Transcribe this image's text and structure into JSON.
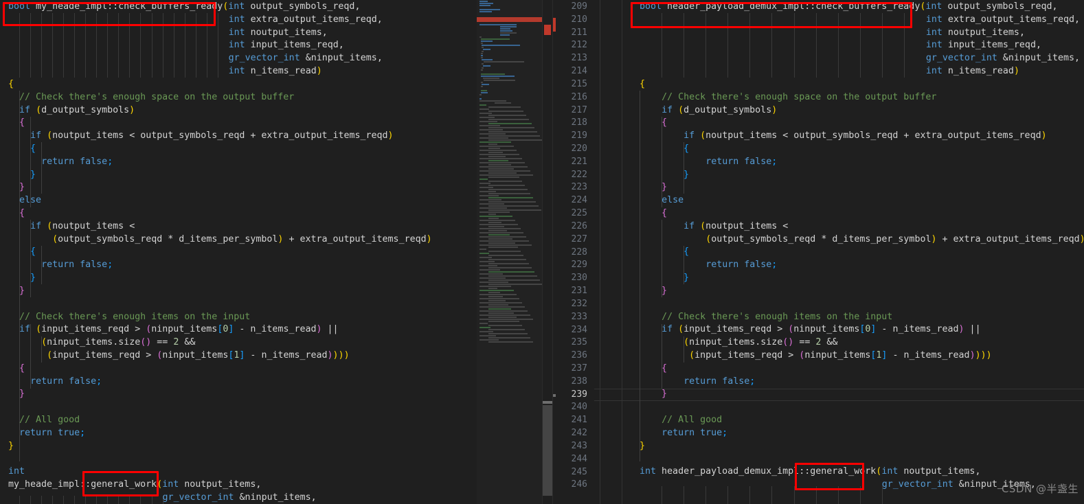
{
  "app": {
    "kind": "code-editor-diff-comparison",
    "theme": "dark-plus",
    "background": "#1f1f1f"
  },
  "watermark": {
    "text": "CSDN @半盏生"
  },
  "left_pane": {
    "name": "left-code-pane",
    "indent_unit": 2,
    "lines": [
      "bool my_heade_impl::check_buffers_ready(int output_symbols_reqd,",
      "                                        int extra_output_items_reqd,",
      "                                        int noutput_items,",
      "                                        int input_items_reqd,",
      "                                        gr_vector_int &ninput_items,",
      "                                        int n_items_read)",
      "{",
      "  // Check there's enough space on the output buffer",
      "  if (d_output_symbols)",
      "  {",
      "    if (noutput_items < output_symbols_reqd + extra_output_items_reqd)",
      "    {",
      "      return false;",
      "    }",
      "  }",
      "  else",
      "  {",
      "    if (noutput_items <",
      "        (output_symbols_reqd * d_items_per_symbol) + extra_output_items_reqd)",
      "    {",
      "      return false;",
      "    }",
      "  }",
      "",
      "  // Check there's enough items on the input",
      "  if (input_items_reqd > (ninput_items[0] - n_items_read) ||",
      "      (ninput_items.size() == 2 &&",
      "       (input_items_reqd > (ninput_items[1] - n_items_read))))",
      "  {",
      "    return false;",
      "  }",
      "",
      "  // All good",
      "  return true;",
      "}",
      "",
      "int",
      "my_heade_impl::general_work(int noutput_items,",
      "                            gr_vector_int &ninput_items,"
    ]
  },
  "right_pane": {
    "name": "right-code-pane",
    "indent_unit": 4,
    "first_line_number": 209,
    "active_line_number": 239,
    "line_numbers": [
      209,
      210,
      211,
      212,
      213,
      214,
      215,
      216,
      217,
      218,
      219,
      220,
      221,
      222,
      223,
      224,
      225,
      226,
      227,
      228,
      229,
      230,
      231,
      232,
      233,
      234,
      235,
      236,
      237,
      238,
      239,
      240,
      241,
      242,
      243,
      244,
      245,
      246
    ],
    "lines": [
      "bool header_payload_demux_impl::check_buffers_ready(int output_symbols_reqd,",
      "                                                    int extra_output_items_reqd,",
      "                                                    int noutput_items,",
      "                                                    int input_items_reqd,",
      "                                                    gr_vector_int &ninput_items,",
      "                                                    int n_items_read)",
      "{",
      "    // Check there's enough space on the output buffer",
      "    if (d_output_symbols)",
      "    {",
      "        if (noutput_items < output_symbols_reqd + extra_output_items_reqd)",
      "        {",
      "            return false;",
      "        }",
      "    }",
      "    else",
      "    {",
      "        if (noutput_items <",
      "            (output_symbols_reqd * d_items_per_symbol) + extra_output_items_reqd)",
      "        {",
      "            return false;",
      "        }",
      "    }",
      "",
      "    // Check there's enough items on the input",
      "    if (input_items_reqd > (ninput_items[0] - n_items_read) ||",
      "        (ninput_items.size() == 2 &&",
      "         (input_items_reqd > (ninput_items[1] - n_items_read))))",
      "    {",
      "        return false;",
      "    }",
      "",
      "    // All good",
      "    return true;",
      "}",
      "",
      "int header_payload_demux_impl::general_work(int noutput_items,",
      "                                            gr_vector_int &ninput_items,"
    ]
  },
  "annotations": [
    {
      "name": "annotation-left-signature",
      "label": "bool my_heade_impl::check_buffers_ready"
    },
    {
      "name": "annotation-right-signature",
      "label": "bool header_payload_demux_impl::check_buffers_ready"
    },
    {
      "name": "annotation-left-general-work",
      "label": "::general_work"
    },
    {
      "name": "annotation-right-general-work",
      "label": "::general_work"
    }
  ],
  "colors": {
    "editor_bg": "#1f1f1f",
    "keyword": "#569cd6",
    "comment": "#6a9955",
    "identifier": "#d4d4d4",
    "number": "#b5cea8",
    "bracket_level_1": "#ffd700",
    "bracket_level_2": "#da70d6",
    "bracket_level_3": "#179fff",
    "annotation": "#ff0000",
    "line_number": "#6e7681",
    "line_number_active": "#cccccc",
    "minimap_highlight": "#c0392b",
    "scrollbar_thumb": "#515151"
  }
}
